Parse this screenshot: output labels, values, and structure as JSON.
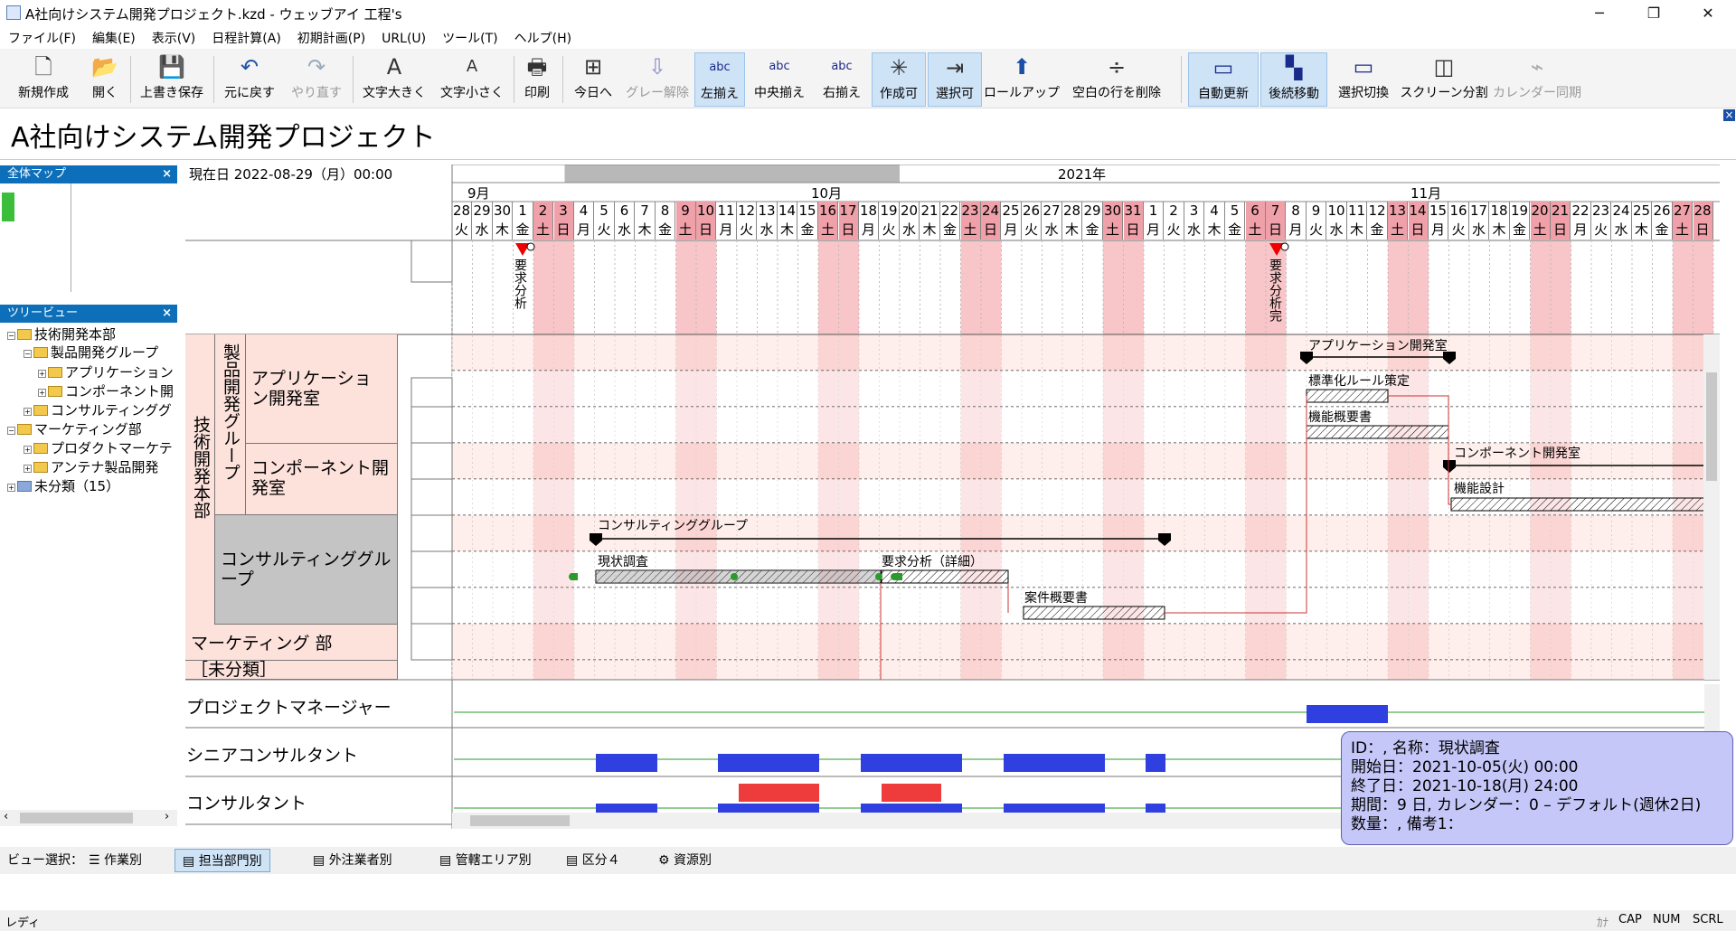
{
  "window": {
    "title": "A社向けシステム開発プロジェクト.kzd - ウェッブアイ 工程's",
    "min": "─",
    "max": "❐",
    "close": "✕"
  },
  "menu": [
    "ファイル(F)",
    "編集(E)",
    "表示(V)",
    "日程計算(A)",
    "初期計画(P)",
    "URL(U)",
    "ツール(T)",
    "ヘルプ(H)"
  ],
  "toolbar": [
    {
      "label": "新規作成",
      "icon": "🗋"
    },
    {
      "label": "開く",
      "icon": "📂"
    },
    {
      "label": "上書き保存",
      "icon": "💾"
    },
    {
      "label": "元に戻す",
      "icon": "↶"
    },
    {
      "label": "やり直す",
      "icon": "↷"
    },
    {
      "label": "文字大きく",
      "icon": "A"
    },
    {
      "label": "文字小さく",
      "icon": "A"
    },
    {
      "label": "印刷",
      "icon": "🖶"
    },
    {
      "label": "今日へ",
      "icon": "⊞"
    },
    {
      "label": "グレー解除",
      "icon": "⇩"
    },
    {
      "label": "左揃え",
      "icon": "abc"
    },
    {
      "label": "中央揃え",
      "icon": "abc"
    },
    {
      "label": "右揃え",
      "icon": "abc"
    },
    {
      "label": "作成可",
      "icon": "✳"
    },
    {
      "label": "選択可",
      "icon": "⇥"
    },
    {
      "label": "ロールアップ",
      "icon": "⬆"
    },
    {
      "label": "空白の行を削除",
      "icon": "÷"
    },
    {
      "label": "自動更新",
      "icon": "▭"
    },
    {
      "label": "後続移動",
      "icon": "▚"
    },
    {
      "label": "選択切換",
      "icon": "▭"
    },
    {
      "label": "スクリーン分割",
      "icon": "◫"
    },
    {
      "label": "カレンダー同期",
      "icon": "⌁"
    }
  ],
  "project_title": "A社向けシステム開発プロジェクト",
  "panels": {
    "overview": "全体マップ",
    "tree": "ツリービュー",
    "close": "×"
  },
  "tree": [
    {
      "label": "技術開発本部"
    },
    {
      "label": "製品開発グループ"
    },
    {
      "label": "アプリケーション"
    },
    {
      "label": "コンポーネント開"
    },
    {
      "label": "コンサルティンググ"
    },
    {
      "label": "マーケティング部"
    },
    {
      "label": "プロダクトマーケテ"
    },
    {
      "label": "アンテナ製品開発"
    },
    {
      "label": "未分類（15）"
    }
  ],
  "current_date": "現在日 2022-08-29（月）00:00",
  "year_label": "2021年",
  "months": [
    "9月",
    "10月",
    "11月"
  ],
  "days": [
    "28",
    "29",
    "30",
    "1",
    "2",
    "3",
    "4",
    "5",
    "6",
    "7",
    "8",
    "9",
    "10",
    "11",
    "12",
    "13",
    "14",
    "15",
    "16",
    "17",
    "18",
    "19",
    "20",
    "21",
    "22",
    "23",
    "24",
    "25",
    "26",
    "27",
    "28",
    "29",
    "30",
    "31",
    "1",
    "2",
    "3",
    "4",
    "5",
    "6",
    "7",
    "8",
    "9",
    "10",
    "11",
    "12",
    "13",
    "14",
    "15",
    "16",
    "17",
    "18",
    "19",
    "20",
    "21",
    "22",
    "23",
    "24",
    "25",
    "26",
    "27",
    "28"
  ],
  "weekdays": [
    "火",
    "水",
    "木",
    "金",
    "土",
    "日",
    "月",
    "火",
    "水",
    "木",
    "金",
    "土",
    "日",
    "月",
    "火",
    "水",
    "木",
    "金",
    "土",
    "日",
    "月",
    "火",
    "水",
    "木",
    "金",
    "土",
    "日",
    "月",
    "火",
    "水",
    "木",
    "金",
    "土",
    "日",
    "月",
    "火",
    "水",
    "木",
    "金",
    "土",
    "日",
    "月",
    "火",
    "水",
    "木",
    "金",
    "土",
    "日",
    "月",
    "火",
    "水",
    "木",
    "金",
    "土",
    "日",
    "月",
    "火",
    "水",
    "木",
    "金",
    "土",
    "日"
  ],
  "milestones": [
    {
      "label": "要求分析"
    },
    {
      "label": "要求分析完"
    }
  ],
  "left": {
    "dept": "技術開発本部",
    "group": "製品開発グループ",
    "app": "アプリケーション開発室",
    "comp": "コンポーネント開発室",
    "consult": "コンサルティンググループ",
    "marketing": "マーケティング 部",
    "unclassified": "［未分類］"
  },
  "tasks": {
    "app_group": "アプリケーション開発室",
    "std_rule": "標準化ルール策定",
    "func_summary": "機能概要書",
    "comp_group": "コンポーネント開発室",
    "func_design": "機能設計",
    "consult_group": "コンサルティンググループ",
    "survey": "現状調査",
    "req_detail": "要求分析（詳細）",
    "case_summary": "案件概要書"
  },
  "resources": [
    "プロジェクトマネージャー",
    "シニアコンサルタント",
    "コンサルタント"
  ],
  "tooltip": {
    "line1": "ID：, 名称：現状調査",
    "line2": "開始日：2021-10-05(火) 00:00",
    "line3": "終了日：2021-10-18(月) 24:00",
    "line4": "期間：9 日, カレンダー：0 – デフォルト(週休2日)",
    "line5": "数量：, 備考1："
  },
  "view_select": {
    "label": "ビュー選択：",
    "items": [
      "作業別",
      "担当部門別",
      "外注業者別",
      "管轄エリア別",
      "区分４",
      "資源別"
    ]
  },
  "status": {
    "left": "レディ",
    "kana": "ｶﾅ",
    "cap": "CAP",
    "num": "NUM",
    "scrl": "SCRL"
  },
  "colors": {
    "weekend": "#f8c5c8",
    "header_weekend": "#f0a0a8",
    "gray_header": "#b8b8b8",
    "row_alt": "#fde2dc",
    "bar_blue": "#2f3fe0",
    "bar_red": "#ee3b3b",
    "tooltip_bg": "#c5c7f8"
  }
}
